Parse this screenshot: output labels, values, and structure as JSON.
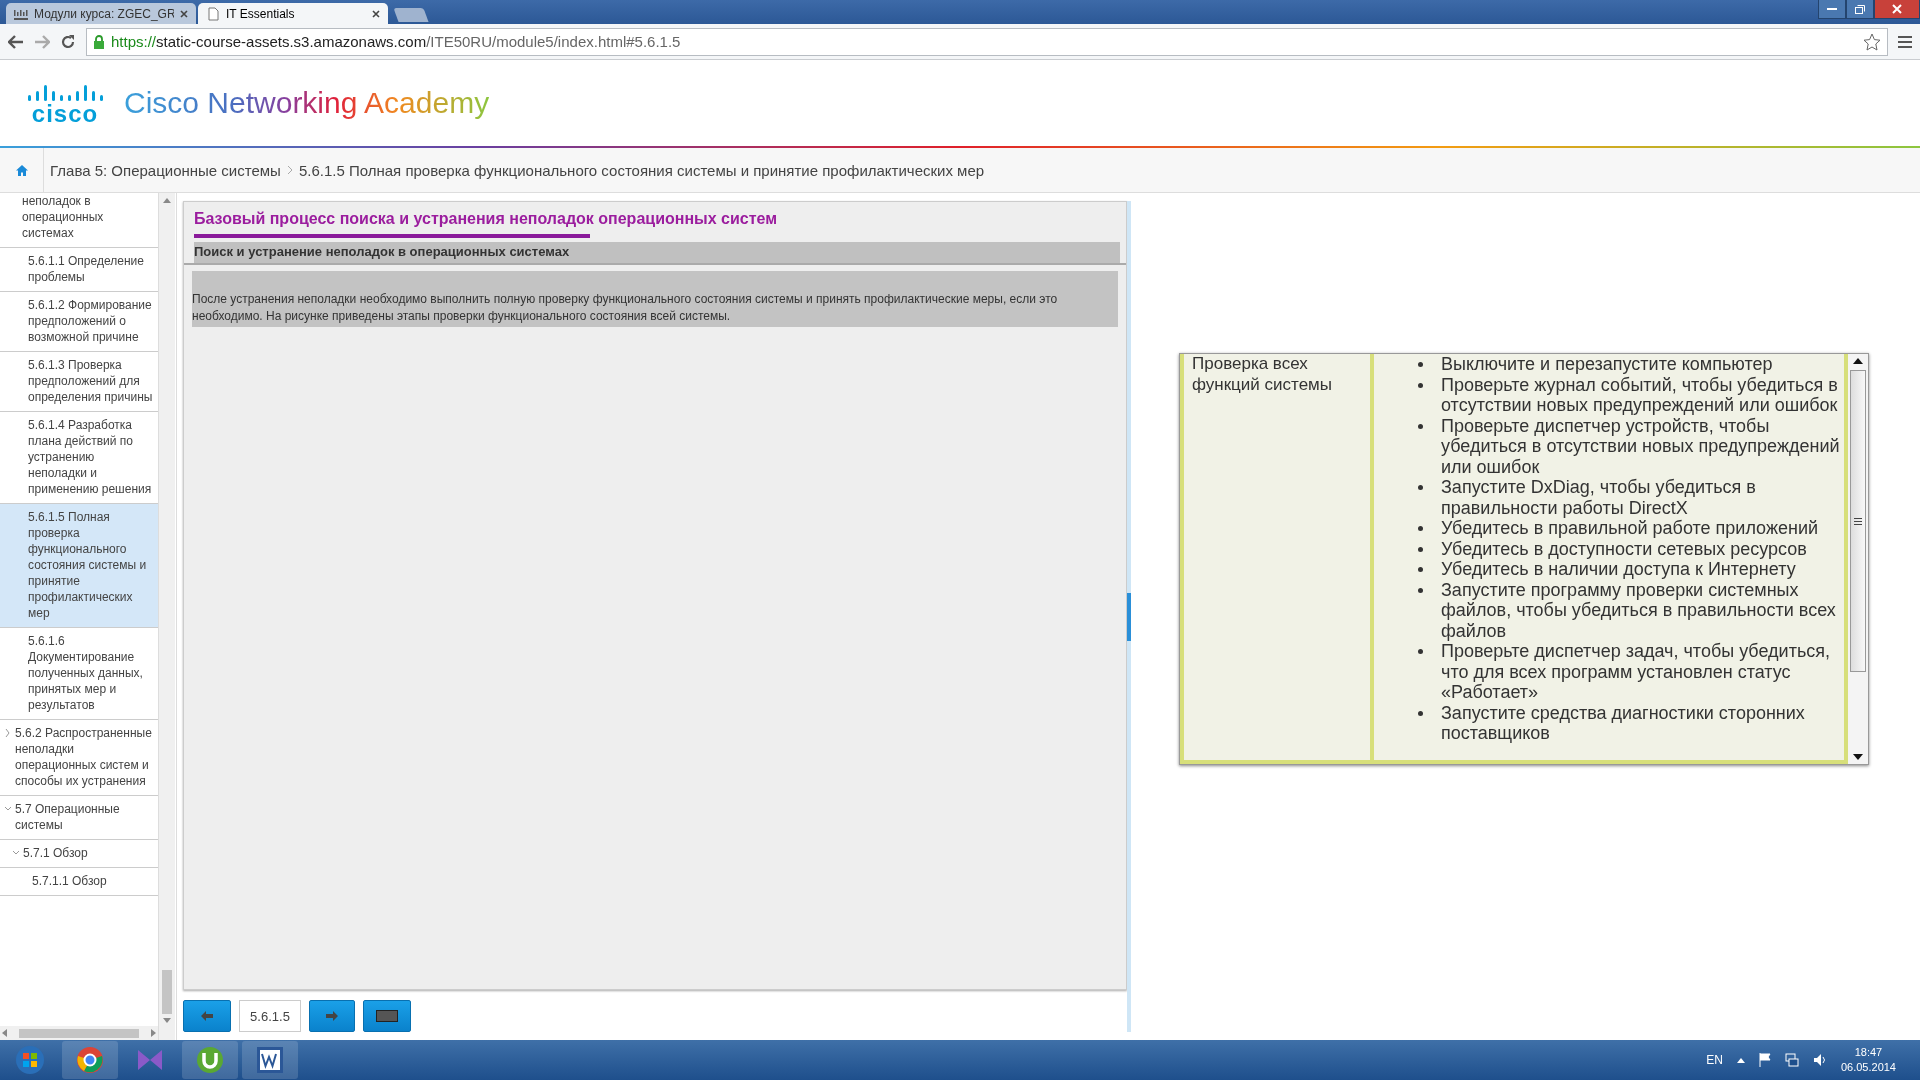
{
  "browser": {
    "tabs": [
      {
        "title": "Модули курса: ZGEC_GR",
        "selected": false
      },
      {
        "title": "IT Essentials",
        "selected": true
      }
    ],
    "url": {
      "scheme": "https://",
      "host": "static-course-assets.s3.amazonaws.com",
      "path": "/ITE50RU/module5/index.html#5.6.1.5"
    }
  },
  "header": {
    "logo": "cisco",
    "title": "Cisco Networking Academy"
  },
  "breadcrumb": [
    "Глава 5: Операционные системы",
    "5.6.1.5 Полная проверка функционального состояния системы и принятие профилактических мер"
  ],
  "sidebar": {
    "items": [
      {
        "label": "неполадок в операционных системах",
        "selected": false,
        "expanded": true,
        "children": [
          {
            "label": "5.6.1.1 Определение проблемы",
            "selected": false
          },
          {
            "label": "5.6.1.2 Формирование предположений о возможной причине",
            "selected": false
          },
          {
            "label": "5.6.1.3 Проверка предположений для определения причины",
            "selected": false
          },
          {
            "label": "5.6.1.4 Разработка плана действий по устранению неполадки и применению решения",
            "selected": false
          },
          {
            "label": "5.6.1.5 Полная проверка функционального состояния системы и принятие профилактических мер",
            "selected": true
          },
          {
            "label": "5.6.1.6 Документирование полученных данных, принятых мер и результатов",
            "selected": false
          }
        ]
      },
      {
        "label": "5.6.2 Распространенные неполадки операционных систем и способы их устранения",
        "selected": false,
        "expanded": false
      },
      {
        "label": "5.7 Операционные системы",
        "selected": false,
        "expanded": true,
        "children": [
          {
            "label": "5.7.1 Обзор",
            "selected": false,
            "expanded": true,
            "children": [
              {
                "label": "5.7.1.1 Обзор",
                "selected": false
              }
            ]
          }
        ]
      }
    ]
  },
  "content": {
    "title": "Базовый процесс поиска и устранения неполадок операционных систем",
    "subtitle": "Поиск и устранение неполадок в операционных системах",
    "text": "После устранения неполадки необходимо выполнить полную проверку функционального состояния системы и принять профилактические меры, если это необходимо. На рисунке приведены этапы проверки функционального состояния всей системы."
  },
  "nav": {
    "page": "5.6.1.5"
  },
  "figure_table": {
    "rows": [
      {
        "label": "Проверка всех функций системы",
        "items": [
          "Выключите и перезапустите компьютер",
          "Проверьте журнал событий, чтобы убедиться в отсутствии новых предупреждений или ошибок",
          "Проверьте диспетчер устройств, чтобы убедиться в отсутствии новых предупреждений или ошибок",
          "Запустите DxDiag, чтобы убедиться в правильности работы DirectX",
          "Убедитесь в правильной работе приложений",
          "Убедитесь в доступности сетевых ресурсов",
          "Убедитесь в наличии доступа к Интернету",
          "Запустите программу проверки системных файлов, чтобы убедиться в правильности всех файлов",
          "Проверьте диспетчер задач, чтобы убедиться, что для всех программ установлен статус «Работает»",
          "Запустите средства диагностики сторонних поставщиков"
        ]
      }
    ]
  },
  "taskbar": {
    "language": "EN",
    "time": "18:47",
    "date": "06.05.2014"
  }
}
